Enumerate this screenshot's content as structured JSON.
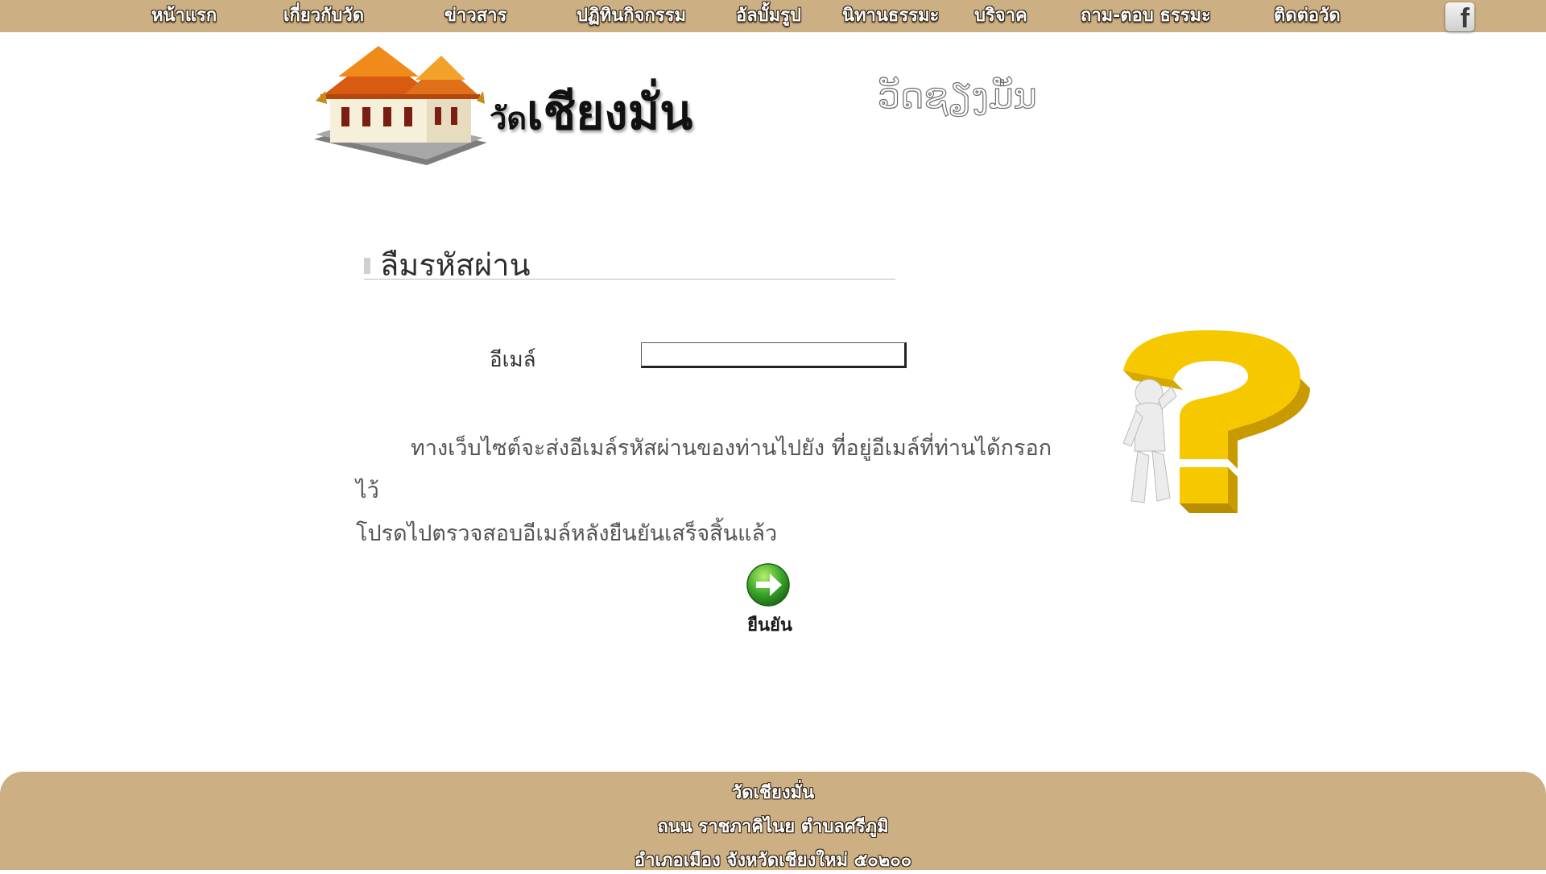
{
  "nav": {
    "items": [
      {
        "label": "หน้าแรก"
      },
      {
        "label": "เกี่ยวกับวัด"
      },
      {
        "label": "ข่าวสาร"
      },
      {
        "label": "ปฏิทินกิจกรรม"
      },
      {
        "label": "อัลบั้มรูป"
      },
      {
        "label": "นิทานธรรมะ"
      },
      {
        "label": "บริจาค"
      },
      {
        "label": "ถาม-ตอบ ธรรมะ"
      },
      {
        "label": "ติดต่อวัด"
      }
    ],
    "facebook_icon": "facebook-icon",
    "facebook_glyph": "f"
  },
  "header": {
    "title_small": "วัด",
    "title_big": "เชียงมั่น",
    "script_text": "ວັດຊຽງມັ່ນ"
  },
  "page": {
    "heading": "ลืมรหัสผ่าน",
    "email_label": "อีเมล์",
    "email_value": "",
    "info_line1": "ทางเว็บไซต์จะส่งอีเมล์รหัสผ่านของท่านไปยัง  ที่อยู่อีเมล์ที่ท่านได้กรอกไว้",
    "info_line2": "โปรดไปตรวจสอบอีเมล์หลังยืนยันเสร็จสิ้นแล้ว",
    "submit_label": "ยืนยัน"
  },
  "footer": {
    "line1": "วัดเชียงมั่น",
    "line2": "ถนน ราชภาคิไนย ตำบลศรีภูมิ",
    "line3": "อำเภอเมือง จังหวัดเชียงใหม่ ๕๐๒๐๐"
  },
  "colors": {
    "bar": "#ccb083",
    "accent_gold": "#f2c200",
    "submit_green": "#3aa62a"
  }
}
